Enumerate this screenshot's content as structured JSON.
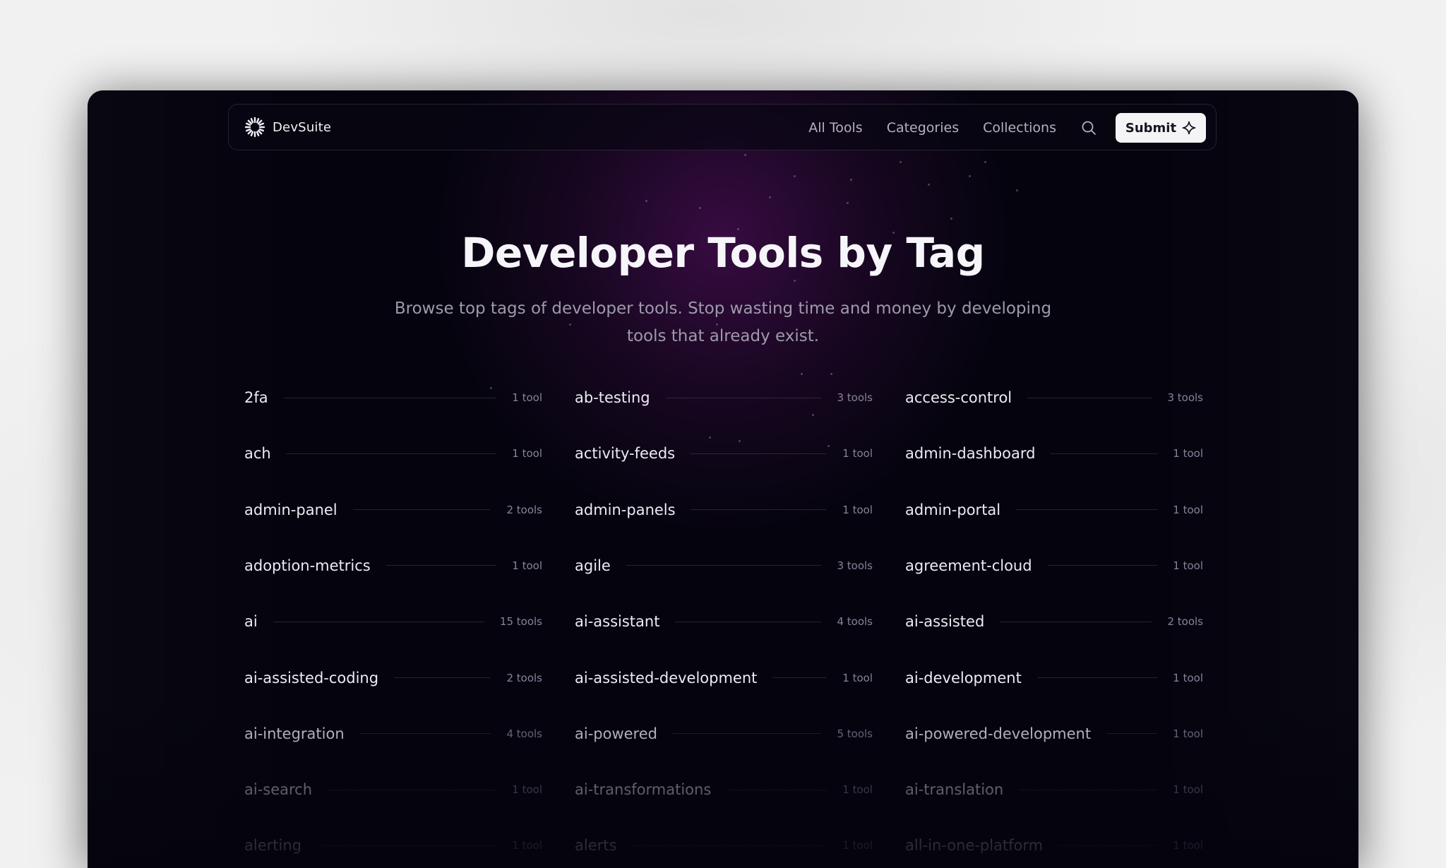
{
  "brand": {
    "name": "DevSuite",
    "logo_icon": "sunburst-logo-icon"
  },
  "nav": {
    "links": [
      "All Tools",
      "Categories",
      "Collections"
    ],
    "search_icon": "search-icon",
    "submit_label": "Submit",
    "submit_icon": "sparkle-icon"
  },
  "hero": {
    "title": "Developer Tools by Tag",
    "subtitle_line1": "Browse top tags of developer tools. Stop wasting time and money by developing",
    "subtitle_line2": "tools that already exist."
  },
  "tags": [
    {
      "name": "2fa",
      "count": "1 tool"
    },
    {
      "name": "ab-testing",
      "count": "3 tools"
    },
    {
      "name": "access-control",
      "count": "3 tools"
    },
    {
      "name": "ach",
      "count": "1 tool"
    },
    {
      "name": "activity-feeds",
      "count": "1 tool"
    },
    {
      "name": "admin-dashboard",
      "count": "1 tool"
    },
    {
      "name": "admin-panel",
      "count": "2 tools"
    },
    {
      "name": "admin-panels",
      "count": "1 tool"
    },
    {
      "name": "admin-portal",
      "count": "1 tool"
    },
    {
      "name": "adoption-metrics",
      "count": "1 tool"
    },
    {
      "name": "agile",
      "count": "3 tools"
    },
    {
      "name": "agreement-cloud",
      "count": "1 tool"
    },
    {
      "name": "ai",
      "count": "15 tools"
    },
    {
      "name": "ai-assistant",
      "count": "4 tools"
    },
    {
      "name": "ai-assisted",
      "count": "2 tools"
    },
    {
      "name": "ai-assisted-coding",
      "count": "2 tools"
    },
    {
      "name": "ai-assisted-development",
      "count": "1 tool"
    },
    {
      "name": "ai-development",
      "count": "1 tool"
    },
    {
      "name": "ai-integration",
      "count": "4 tools"
    },
    {
      "name": "ai-powered",
      "count": "5 tools"
    },
    {
      "name": "ai-powered-development",
      "count": "1 tool"
    },
    {
      "name": "ai-search",
      "count": "1 tool"
    },
    {
      "name": "ai-transformations",
      "count": "1 tool"
    },
    {
      "name": "ai-translation",
      "count": "1 tool"
    },
    {
      "name": "alerting",
      "count": "1 tool"
    },
    {
      "name": "alerts",
      "count": "1 tool"
    },
    {
      "name": "all-in-one-platform",
      "count": "1 tool"
    }
  ]
}
